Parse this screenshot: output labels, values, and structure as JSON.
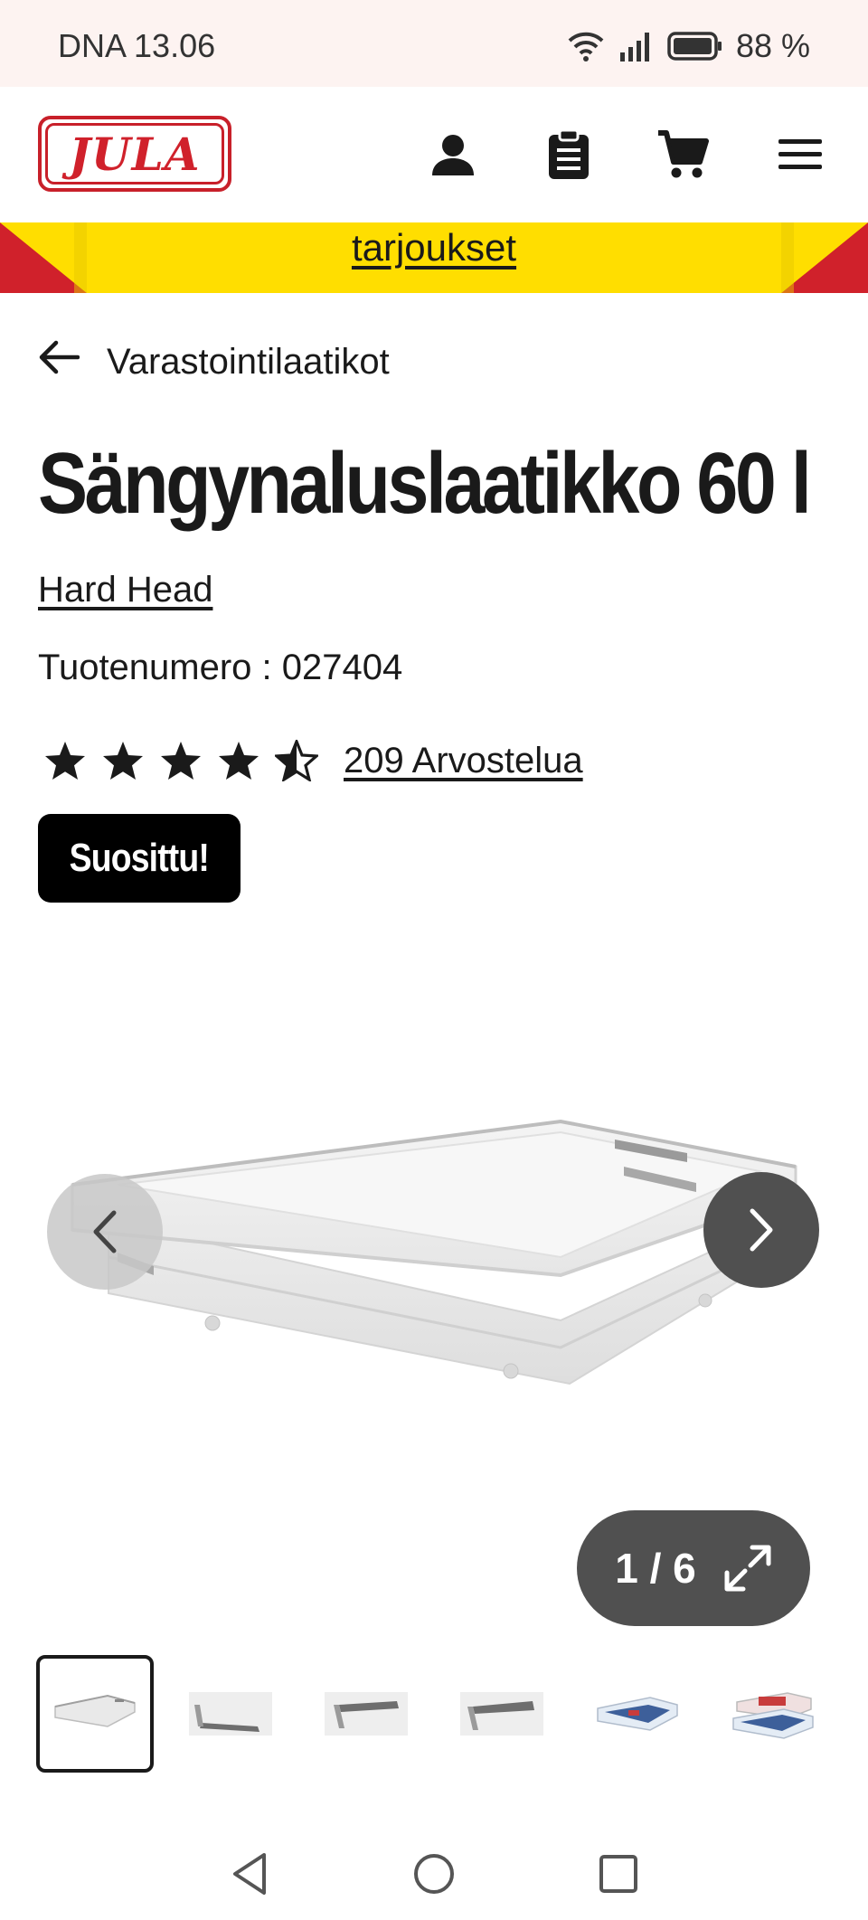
{
  "status_bar": {
    "carrier_time": "DNA 13.06",
    "battery": "88 %"
  },
  "header": {
    "logo_text": "JULA",
    "icons": [
      "account-icon",
      "shopping-list-icon",
      "cart-icon",
      "menu-icon"
    ]
  },
  "banner": {
    "link_text": "tarjoukset"
  },
  "breadcrumb": {
    "label": "Varastointilaatikot"
  },
  "product": {
    "title": "Sängynaluslaatikko 60 l",
    "brand": "Hard Head",
    "sku": "Tuotenumero : 027404",
    "rating": 4.5,
    "rating_max": 5,
    "reviews": "209 Arvostelua",
    "badge": "Suosittu!"
  },
  "gallery": {
    "counter": "1 / 6",
    "current": 1,
    "total": 6
  },
  "colors": {
    "brand_red": "#d0212b",
    "banner_yellow": "#ffde00",
    "dark_button": "#505050"
  }
}
